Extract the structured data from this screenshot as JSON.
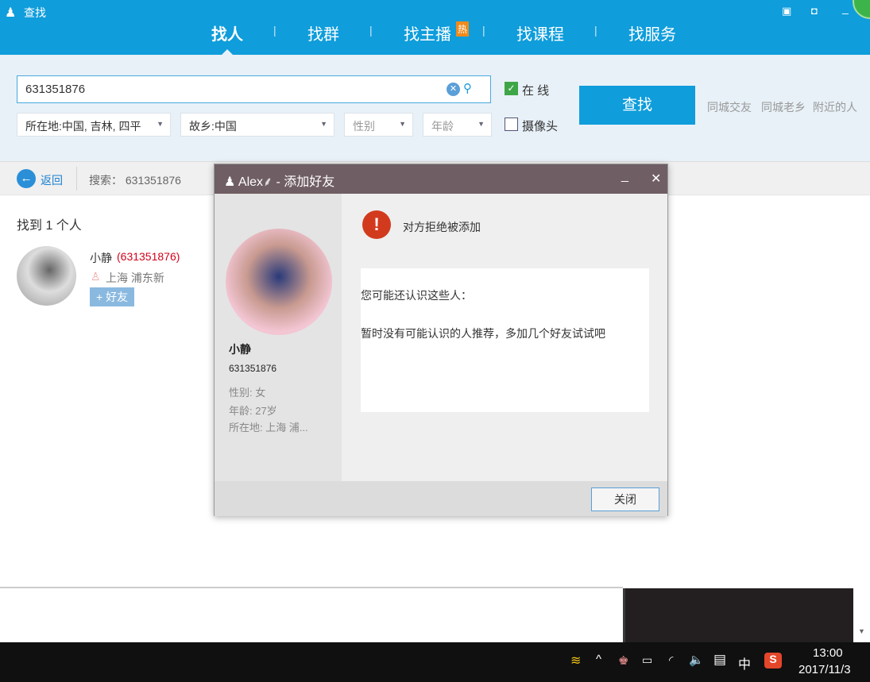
{
  "window": {
    "title": "查找"
  },
  "tabs": [
    {
      "label": "找人"
    },
    {
      "label": "找群"
    },
    {
      "label": "找主播",
      "badge": "热"
    },
    {
      "label": "找课程"
    },
    {
      "label": "找服务"
    }
  ],
  "search": {
    "value": "631351876",
    "location": "所在地:中国, 吉林, 四平",
    "hometown": "故乡:中国",
    "gender": "性别",
    "age": "年龄",
    "online_label": "在  线",
    "camera_label": "摄像头",
    "online_checked": true,
    "camera_checked": false,
    "button": "查找",
    "links": [
      "同城交友",
      "同城老乡",
      "附近的人"
    ]
  },
  "bar": {
    "back": "返回",
    "query": "搜索： 631351876"
  },
  "results": {
    "count": "找到 1 个人",
    "items": [
      {
        "name": "小静",
        "id": "(631351876)",
        "location": "上海  浦东新",
        "add": "+ 好友"
      }
    ]
  },
  "dialog": {
    "title": "Alex⸙ - 添加好友",
    "name": "小静",
    "id": "631351876",
    "gender": "性别: 女",
    "age": "年龄: 27岁",
    "location": "所在地: 上海  浦...",
    "message": "对方拒绝被添加",
    "suggest_title": "您可能还认识这些人：",
    "suggest_empty": "暂时没有可能认识的人推荐，多加几个好友试试吧",
    "close": "关闭"
  },
  "taskbar": {
    "time": "13:00",
    "date": "2017/11/3",
    "ime": "中"
  },
  "colors": {
    "accent": "#0f9ddb",
    "dialog_header": "#6f5e63",
    "id_red": "#d0021b"
  }
}
